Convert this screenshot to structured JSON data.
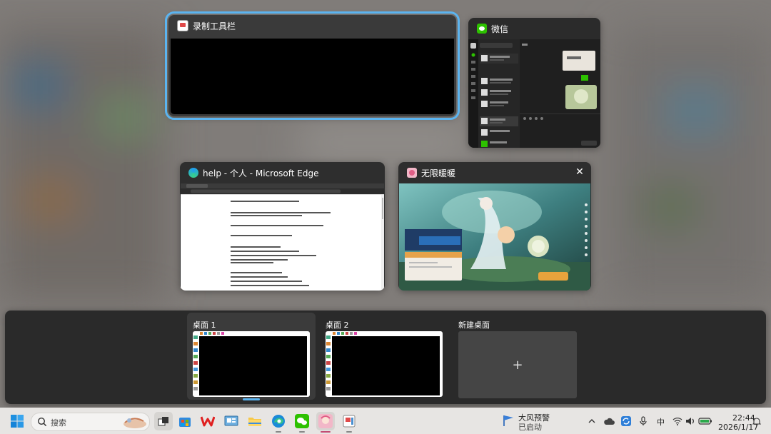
{
  "windows": {
    "recorder": {
      "title": "录制工具栏"
    },
    "wechat": {
      "title": "微信"
    },
    "edge": {
      "title": "help - 个人 - Microsoft Edge"
    },
    "game": {
      "title": "无限暖暖",
      "close_glyph": "✕"
    }
  },
  "desktops": [
    {
      "label": "桌面 1"
    },
    {
      "label": "桌面 2"
    }
  ],
  "new_desktop": {
    "label": "新建桌面",
    "plus": "+"
  },
  "taskbar": {
    "search_placeholder": "搜索",
    "weather_title": "大风预警",
    "weather_status": "已启动",
    "ime": "中",
    "time": "22:44",
    "date": "2026/1/17"
  },
  "colors": {
    "accent": "#5bb4f0",
    "taskbar": "#e7e5e3"
  }
}
